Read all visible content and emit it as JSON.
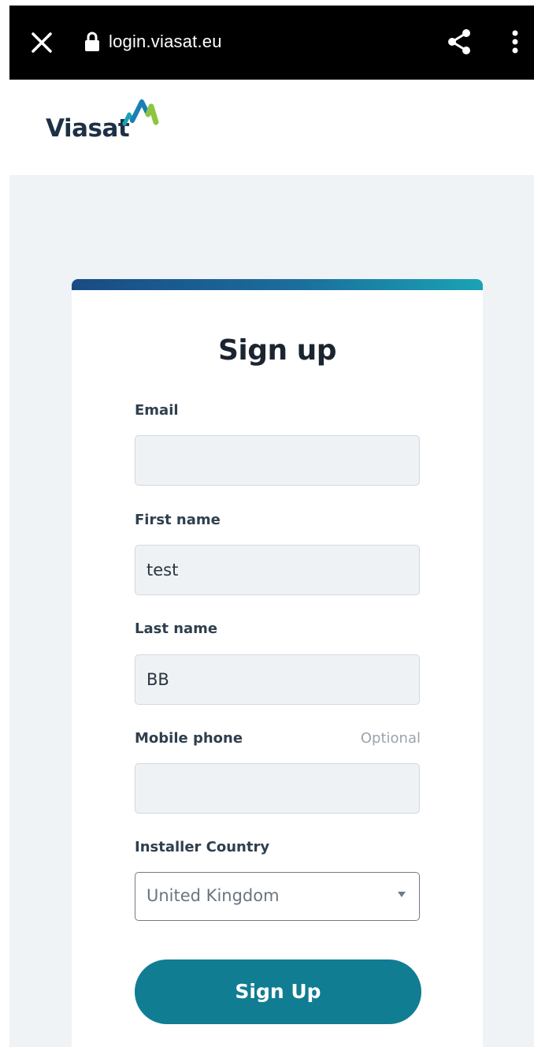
{
  "browser": {
    "url": "login.viasat.eu",
    "close_icon": "close-icon",
    "lock_icon": "lock-icon",
    "share_icon": "share-icon",
    "more_icon": "more-vertical-icon"
  },
  "header": {
    "logo_text": "Viasat"
  },
  "form": {
    "title": "Sign up",
    "email": {
      "label": "Email",
      "value": ""
    },
    "first_name": {
      "label": "First name",
      "value": "test"
    },
    "last_name": {
      "label": "Last name",
      "value": "BB"
    },
    "mobile_phone": {
      "label": "Mobile phone",
      "optional_text": "Optional",
      "value": ""
    },
    "installer_country": {
      "label": "Installer Country",
      "selected": "United Kingdom"
    },
    "submit_label": "Sign Up"
  },
  "colors": {
    "accent": "#107d93",
    "page_background": "#eff3f6",
    "logo_green": "#8cc63f",
    "logo_blue": "#1aa3b4"
  }
}
